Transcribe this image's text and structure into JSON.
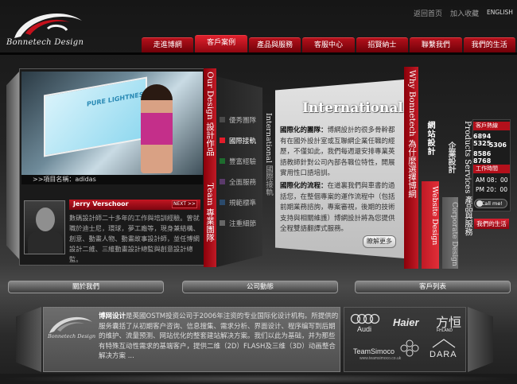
{
  "brand": {
    "logo_text": "Bonnetech Design"
  },
  "top_links": {
    "home": "返回首页",
    "favorite": "加入收藏",
    "english": "ENGLISH"
  },
  "nav": [
    {
      "label": "走進博網"
    },
    {
      "label": "客戶案例"
    },
    {
      "label": "產品與服務"
    },
    {
      "label": "客服中心"
    },
    {
      "label": "招賢納士"
    },
    {
      "label": "聯繫我們"
    },
    {
      "label": "我們的生活"
    }
  ],
  "left_panel": {
    "strip_title": "Our Design 設計作品",
    "strip_title_2": "Team 專業團隊",
    "caption": ">>項目名稱：adidas",
    "person_name": "Jerry Verschoor",
    "next_label": "NEXT >>",
    "person_desc": "數碼設計師二十多年的工作與培訓經驗。曾就職於迪士尼，環球，夢工廠等，現身兼結構、創意、動畫人物、動畫故事設計師，並任博網設計二維、三維動畫設計總監與創意設計總監。"
  },
  "menu": [
    {
      "label": "優秀團隊",
      "active": false
    },
    {
      "label": "國際接軌",
      "active": true
    },
    {
      "label": "豐富經驗",
      "active": false
    },
    {
      "label": "全面服務",
      "active": false
    },
    {
      "label": "規範標準",
      "active": false
    },
    {
      "label": "注重細節",
      "active": false
    }
  ],
  "vertical_label": {
    "en": "International",
    "zh": "國際接軌"
  },
  "center": {
    "title": "International",
    "p1_title": "國際化的團隊：",
    "p1_text": "博網設計的很多骨幹都有在國外設計室或互聯網企業任職的經歷，不僅如此，我們每週還安排專業英語教師針對公司內部各職位特性，開展實用性口語培訓。",
    "p2_title": "國際化的流程：",
    "p2_text": "在道裏我們與車書的過話您，在整個專案的運作流程中（包括前期業務諮詢，專案審視，後期的技術支持與相關維護）博網設計將為您提供全程雙語翻譯式服務。",
    "more_label": "瞭解更多"
  },
  "right": {
    "strip_title": "Why Bonnetech 為什麼選擇博網",
    "web_label": "網站設計",
    "web_en": "Website Design",
    "corp_label": "企業設計",
    "corp_en": "Corporate Design",
    "products_label": "Products Services 產品與服務"
  },
  "contact": {
    "hotline_label": "客戶熱線",
    "phone1": "6894 5325",
    "phone1b": "5306",
    "phone2": "8586 8768",
    "hours_label": "工作時間",
    "hours_am": "AM 08：00",
    "hours_pm": "PM 20：00",
    "call_label": "Call me!",
    "life_label": "我們的生活"
  },
  "section_tabs": {
    "about": "關於我們",
    "news": "公司動態",
    "clients": "客戶列表"
  },
  "about": {
    "lead": "博网设计",
    "text": "是英國OSTM投资公司于2006年注资的专业国际化设计机构。所提供的服务囊括了从初期客户咨询、信息搜集、需求分析、界面设计、程序编写到后期的维护、流量预测、网站优化的整套建站解决方案。我们以此为基础，并为那些有特殊互动性需求的基端客户，提供二维（2D）FLASH及三维（3D）动画整合解决方案 ..."
  },
  "clients": {
    "audi": "Audi",
    "haier": "Haier",
    "cn_brand": "方恒",
    "cn_sub": "FHLAND",
    "teamsimoco": "TeamSimoco",
    "teamsimoco_sub": "www.teamsimoco.co.uk",
    "dara": "DARA"
  }
}
